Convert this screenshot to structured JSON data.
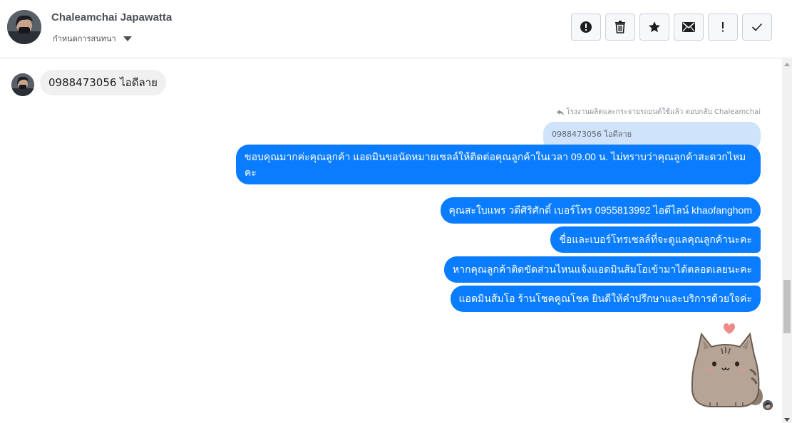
{
  "header": {
    "contact_name": "Chaleamchai Japawatta",
    "label_dropdown": "กำหนดการสนทนา",
    "toolbar": [
      {
        "name": "spam-button",
        "icon": "alert-circle-icon"
      },
      {
        "name": "delete-button",
        "icon": "trash-icon"
      },
      {
        "name": "star-button",
        "icon": "star-icon"
      },
      {
        "name": "mark-unread-button",
        "icon": "envelope-icon"
      },
      {
        "name": "mark-important-button",
        "icon": "exclamation-icon"
      },
      {
        "name": "mark-done-button",
        "icon": "checkmark-icon"
      }
    ]
  },
  "conversation": {
    "incoming_message": "0988473056 ไอดีลาย",
    "reply_note": "โรงงานผลิตและกระจายรถยนต์ใช้แล้ว ตอบกลับ Chaleamchai",
    "quoted_message": "0988473056 ไอดีลาย",
    "outgoing_messages": [
      "ขอบคุณมากค่ะคุณลูกค้า แอดมินขอนัดหมายเซลล์ให้ติดต่อคุณลูกค้าในเวลา 09.00 น. ไม่ทราบว่าคุณลูกค้าสะดวกไหมคะ",
      "คุณสะใบแพร วดีศิริศักดิ์ เบอร์โทร 0955813992  ไอดีไลน์  khaofanghom",
      "ชื่อและเบอร์โทรเซลล์ที่จะดูแลคุณลูกค้านะคะ",
      "หากคุณลูกค้าติดขัดส่วนไหนแจ้งแอดมินส้มโอเข้ามาได้ตลอดเลยนะคะ",
      "แอดมินส้มโอ ร้านโชคคูณโชค ยินดีให้คำปรึกษาและบริการด้วยใจค่ะ"
    ]
  },
  "colors": {
    "outgoing_bubble": "#0a7cff",
    "incoming_bubble": "#f1f0f0",
    "quoted_bubble": "#cfe3fa"
  }
}
